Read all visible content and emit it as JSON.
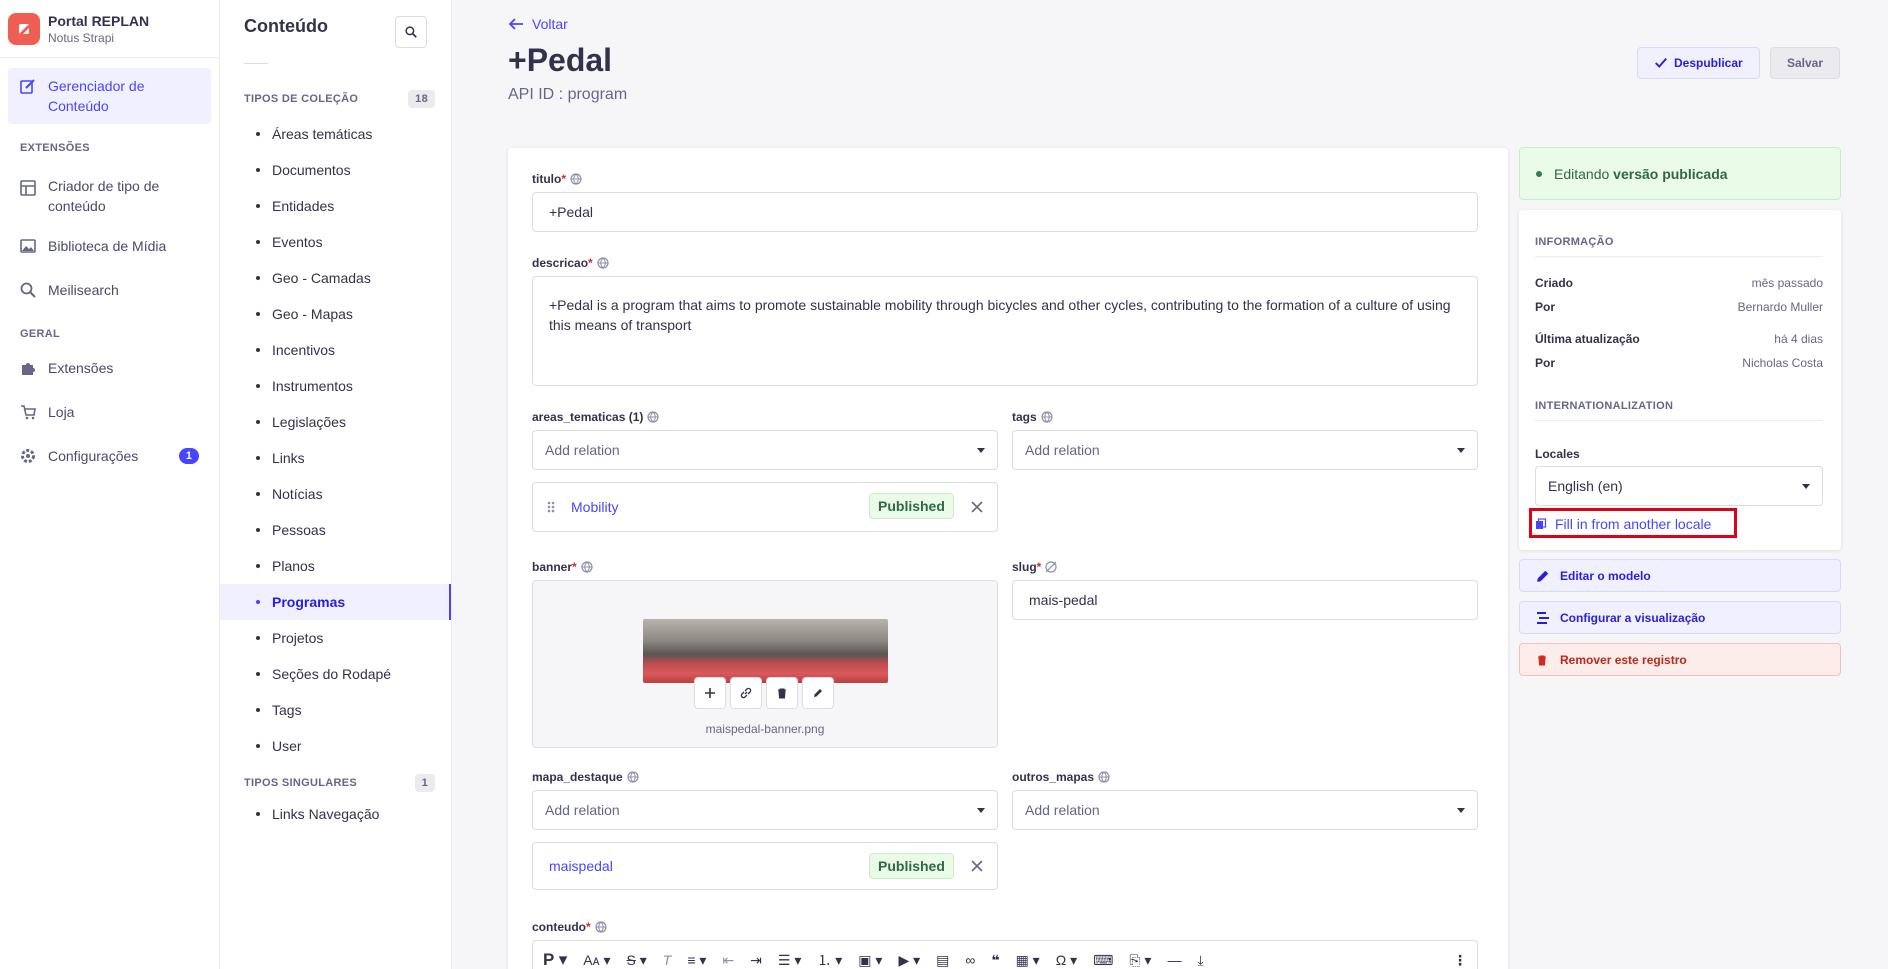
{
  "app": {
    "title": "Portal REPLAN",
    "subtitle": "Notus Strapi"
  },
  "leftnav": {
    "content_manager": "Gerenciador de Conteúdo",
    "section_extensions": "EXTENSÕES",
    "content_type_builder": "Criador de tipo de conteúdo",
    "media_library": "Biblioteca de Mídia",
    "meilisearch": "Meilisearch",
    "section_general": "GERAL",
    "extensions": "Extensões",
    "store": "Loja",
    "settings": "Configurações",
    "settings_badge": "1"
  },
  "subnav": {
    "title": "Conteúdo",
    "collection_types_label": "TIPOS DE COLEÇÃO",
    "collection_types_count": "18",
    "collection_types": [
      "Áreas temáticas",
      "Documentos",
      "Entidades",
      "Eventos",
      "Geo - Camadas",
      "Geo - Mapas",
      "Incentivos",
      "Instrumentos",
      "Legislações",
      "Links",
      "Notícias",
      "Pessoas",
      "Planos",
      "Programas",
      "Projetos",
      "Seções do Rodapé",
      "Tags",
      "User"
    ],
    "single_types_label": "TIPOS SINGULARES",
    "single_types_count": "1",
    "single_types": [
      "Links Navegação"
    ]
  },
  "header": {
    "back": "Voltar",
    "title": "+Pedal",
    "api_id": "API ID : program",
    "unpublish": "Despublicar",
    "save": "Salvar"
  },
  "form": {
    "titulo_label": "titulo",
    "titulo_value": "+Pedal",
    "descricao_label": "descricao",
    "descricao_value": "+Pedal is a program that aims to promote sustainable mobility through bicycles and other cycles, contributing to the formation of a culture of using this means of transport",
    "areas_label": "areas_tematicas (1)",
    "areas_placeholder": "Add relation",
    "areas_item": "Mobility",
    "areas_item_status": "Published",
    "tags_label": "tags",
    "tags_placeholder": "Add relation",
    "banner_label": "banner",
    "banner_filename": "maispedal-banner.png",
    "slug_label": "slug",
    "slug_value": "mais-pedal",
    "mapa_label": "mapa_destaque",
    "mapa_placeholder": "Add relation",
    "mapa_item": "maispedal",
    "mapa_item_status": "Published",
    "outros_label": "outros_mapas",
    "outros_placeholder": "Add relation",
    "conteudo_label": "conteudo",
    "required_mark": "*"
  },
  "sidebar": {
    "status_prefix": "Editando",
    "status_strong": "versão publicada",
    "info_title": "INFORMAÇÃO",
    "created_label": "Criado",
    "created_value": "mês passado",
    "by_label": "Por",
    "created_by": "Bernardo Muller",
    "updated_label": "Última atualização",
    "updated_value": "há 4 dias",
    "updated_by": "Nicholas Costa",
    "i18n_title": "INTERNATIONALIZATION",
    "locales_label": "Locales",
    "locale_value": "English (en)",
    "fill_locale": "Fill in from another locale",
    "edit_model": "Editar o modelo",
    "configure_view": "Configurar a visualização",
    "delete": "Remover este registro"
  },
  "colors": {
    "accent": "#4945ff",
    "success": "#328048",
    "danger": "#d02b20",
    "highlight": "#e1001a"
  }
}
